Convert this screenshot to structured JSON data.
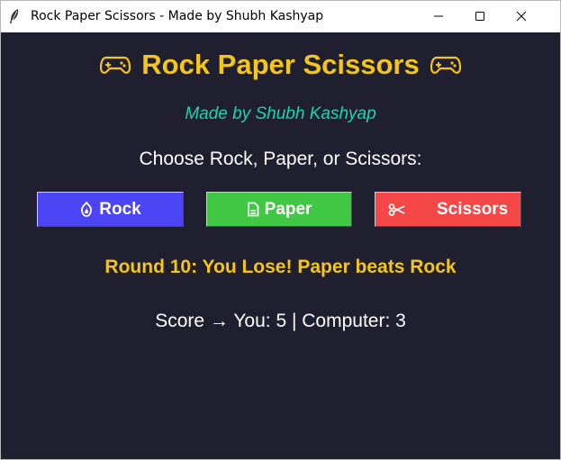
{
  "window": {
    "title": "Rock Paper Scissors - Made by Shubh Kashyap",
    "app_icon": "feather-icon",
    "controls": [
      "minimize-icon",
      "maximize-icon",
      "close-icon"
    ]
  },
  "game": {
    "title": "Rock Paper Scissors",
    "title_icon": "gamepad-icon",
    "subtitle": "Made by Shubh Kashyap",
    "prompt": "Choose Rock, Paper, or Scissors:",
    "buttons": [
      {
        "label": "Rock",
        "icon": "rock-icon",
        "color": "#4b45f6"
      },
      {
        "label": "Paper",
        "icon": "paper-icon",
        "color": "#40c845"
      },
      {
        "label": "Scissors",
        "icon": "scissors-icon",
        "color": "#f54747"
      }
    ],
    "result": "Round 10: You Lose! Paper beats Rock",
    "score": "Score → You: 5 | Computer: 3"
  },
  "colors": {
    "background": "#1f1f30",
    "accent_yellow": "#f5c518",
    "accent_teal": "#1fd3b0",
    "text": "#ffffff"
  }
}
